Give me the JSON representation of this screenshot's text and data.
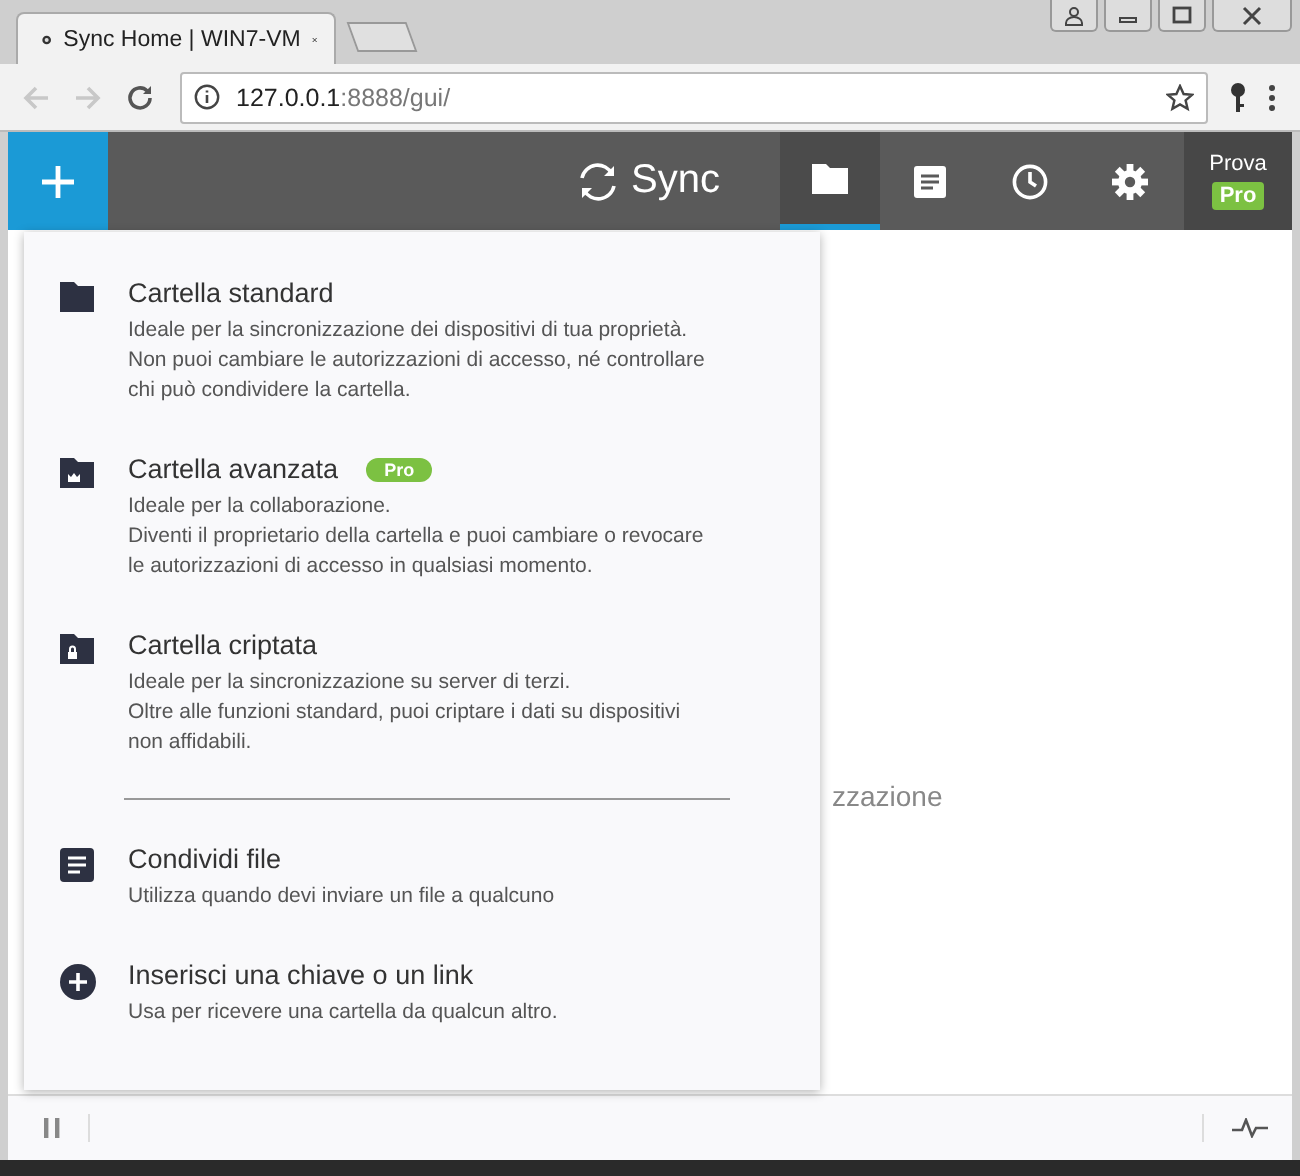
{
  "browser": {
    "tab_title": "Sync Home | WIN7-VM",
    "url_host": "127.0.0.1",
    "url_rest": ":8888/gui/"
  },
  "header": {
    "logo": "Sync",
    "nav": [
      {
        "kind": "folders",
        "selected": true
      },
      {
        "kind": "document",
        "selected": false
      },
      {
        "kind": "history",
        "selected": false
      },
      {
        "kind": "settings",
        "selected": false
      }
    ],
    "account": {
      "label": "Prova",
      "badge": "Pro"
    }
  },
  "menu": {
    "items": [
      {
        "kind": "folder",
        "title": "Cartella standard",
        "lines": [
          "Ideale per la sincronizzazione dei dispositivi di tua proprietà.",
          "Non puoi cambiare le autorizzazioni di accesso, né controllare",
          "chi può condividere la cartella."
        ]
      },
      {
        "kind": "folder-crown",
        "title": "Cartella avanzata",
        "badge": "Pro",
        "lines": [
          "Ideale per la collaborazione.",
          "Diventi il proprietario della cartella e puoi cambiare o revocare",
          "le autorizzazioni di accesso in qualsiasi momento."
        ]
      },
      {
        "kind": "folder-lock",
        "title": "Cartella criptata",
        "lines": [
          "Ideale per la sincronizzazione su server di terzi.",
          "Oltre alle funzioni standard, puoi criptare i dati su dispositivi",
          "non affidabili."
        ]
      },
      {
        "kind": "divider"
      },
      {
        "kind": "document",
        "title": "Condividi file",
        "lines": [
          "Utilizza quando devi inviare un file a qualcuno"
        ]
      },
      {
        "kind": "plus-circle",
        "title": "Inserisci una chiave o un link",
        "lines": [
          "Usa per ricevere una cartella da qualcun altro."
        ]
      }
    ]
  },
  "background_text": "zzazione"
}
